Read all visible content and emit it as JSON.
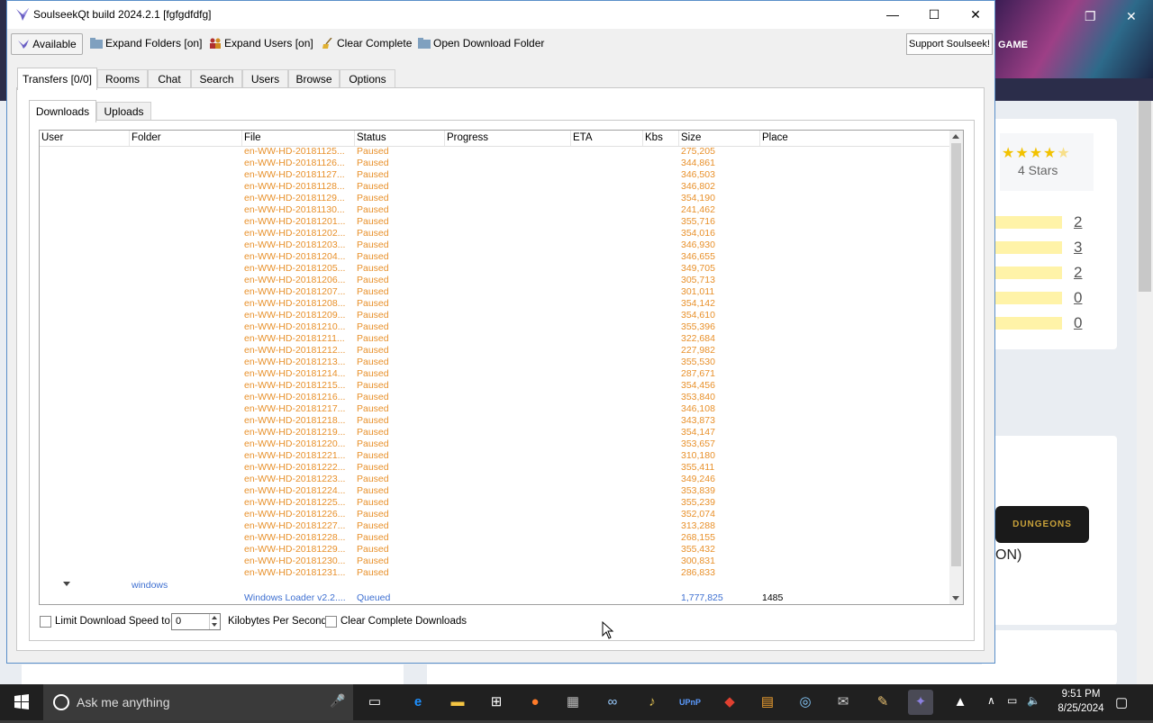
{
  "window": {
    "title": "SoulseekQt build 2024.2.1 [fgfgdfdfg]",
    "controls": {
      "minimize": "—",
      "maximize": "☐",
      "close": "✕"
    }
  },
  "toolbar": {
    "available": "Available",
    "expand_folders": "Expand Folders [on]",
    "expand_users": "Expand Users [on]",
    "clear_complete": "Clear Complete",
    "open_download_folder": "Open Download Folder",
    "support": "Support Soulseek!"
  },
  "tabs": [
    "Transfers [0/0]",
    "Rooms",
    "Chat",
    "Search",
    "Users",
    "Browse",
    "Options"
  ],
  "subtabs": [
    "Downloads",
    "Uploads"
  ],
  "table": {
    "columns": [
      "User",
      "Folder",
      "File",
      "Status",
      "Progress",
      "ETA",
      "Kbs",
      "Size",
      "Place"
    ],
    "rows": [
      {
        "file": "en-WW-HD-20181125...",
        "status": "Paused",
        "size": "275,205"
      },
      {
        "file": "en-WW-HD-20181126...",
        "status": "Paused",
        "size": "344,861"
      },
      {
        "file": "en-WW-HD-20181127...",
        "status": "Paused",
        "size": "346,503"
      },
      {
        "file": "en-WW-HD-20181128...",
        "status": "Paused",
        "size": "346,802"
      },
      {
        "file": "en-WW-HD-20181129...",
        "status": "Paused",
        "size": "354,190"
      },
      {
        "file": "en-WW-HD-20181130...",
        "status": "Paused",
        "size": "241,462"
      },
      {
        "file": "en-WW-HD-20181201...",
        "status": "Paused",
        "size": "355,716"
      },
      {
        "file": "en-WW-HD-20181202...",
        "status": "Paused",
        "size": "354,016"
      },
      {
        "file": "en-WW-HD-20181203...",
        "status": "Paused",
        "size": "346,930"
      },
      {
        "file": "en-WW-HD-20181204...",
        "status": "Paused",
        "size": "346,655"
      },
      {
        "file": "en-WW-HD-20181205...",
        "status": "Paused",
        "size": "349,705"
      },
      {
        "file": "en-WW-HD-20181206...",
        "status": "Paused",
        "size": "305,713"
      },
      {
        "file": "en-WW-HD-20181207...",
        "status": "Paused",
        "size": "301,011"
      },
      {
        "file": "en-WW-HD-20181208...",
        "status": "Paused",
        "size": "354,142"
      },
      {
        "file": "en-WW-HD-20181209...",
        "status": "Paused",
        "size": "354,610"
      },
      {
        "file": "en-WW-HD-20181210...",
        "status": "Paused",
        "size": "355,396"
      },
      {
        "file": "en-WW-HD-20181211...",
        "status": "Paused",
        "size": "322,684"
      },
      {
        "file": "en-WW-HD-20181212...",
        "status": "Paused",
        "size": "227,982"
      },
      {
        "file": "en-WW-HD-20181213...",
        "status": "Paused",
        "size": "355,530"
      },
      {
        "file": "en-WW-HD-20181214...",
        "status": "Paused",
        "size": "287,671"
      },
      {
        "file": "en-WW-HD-20181215...",
        "status": "Paused",
        "size": "354,456"
      },
      {
        "file": "en-WW-HD-20181216...",
        "status": "Paused",
        "size": "353,840"
      },
      {
        "file": "en-WW-HD-20181217...",
        "status": "Paused",
        "size": "346,108"
      },
      {
        "file": "en-WW-HD-20181218...",
        "status": "Paused",
        "size": "343,873"
      },
      {
        "file": "en-WW-HD-20181219...",
        "status": "Paused",
        "size": "354,147"
      },
      {
        "file": "en-WW-HD-20181220...",
        "status": "Paused",
        "size": "353,657"
      },
      {
        "file": "en-WW-HD-20181221...",
        "status": "Paused",
        "size": "310,180"
      },
      {
        "file": "en-WW-HD-20181222...",
        "status": "Paused",
        "size": "355,411"
      },
      {
        "file": "en-WW-HD-20181223...",
        "status": "Paused",
        "size": "349,246"
      },
      {
        "file": "en-WW-HD-20181224...",
        "status": "Paused",
        "size": "353,839"
      },
      {
        "file": "en-WW-HD-20181225...",
        "status": "Paused",
        "size": "355,239"
      },
      {
        "file": "en-WW-HD-20181226...",
        "status": "Paused",
        "size": "352,074"
      },
      {
        "file": "en-WW-HD-20181227...",
        "status": "Paused",
        "size": "313,288"
      },
      {
        "file": "en-WW-HD-20181228...",
        "status": "Paused",
        "size": "268,155"
      },
      {
        "file": "en-WW-HD-20181229...",
        "status": "Paused",
        "size": "355,432"
      },
      {
        "file": "en-WW-HD-20181230...",
        "status": "Paused",
        "size": "300,831"
      },
      {
        "file": "en-WW-HD-20181231...",
        "status": "Paused",
        "size": "286,833"
      }
    ],
    "folder_row": {
      "folder": "windows"
    },
    "queued_row": {
      "file": "Windows Loader v2.2....",
      "status": "Queued",
      "size": "1,777,825",
      "place": "1485"
    }
  },
  "bottom": {
    "limit_label": "Limit Download Speed to",
    "speed_value": "0",
    "unit_label": "Kilobytes Per Second",
    "clear_label": "Clear Complete Downloads"
  },
  "background_page": {
    "stars_label": "4 Stars",
    "rating_counts": [
      "2",
      "3",
      "2",
      "0",
      "0"
    ],
    "game_logo_text": "DUNGEONS",
    "partial_text": "ON)",
    "banner_text": "GAME"
  },
  "taskbar": {
    "search_placeholder": "Ask me anything",
    "time": "9:51 PM",
    "date": "8/25/2024"
  },
  "colors": {
    "paused": "#e8902a",
    "queued": "#3d6fd1",
    "taskbar": "#202020",
    "window_border": "#5a8fc9"
  }
}
